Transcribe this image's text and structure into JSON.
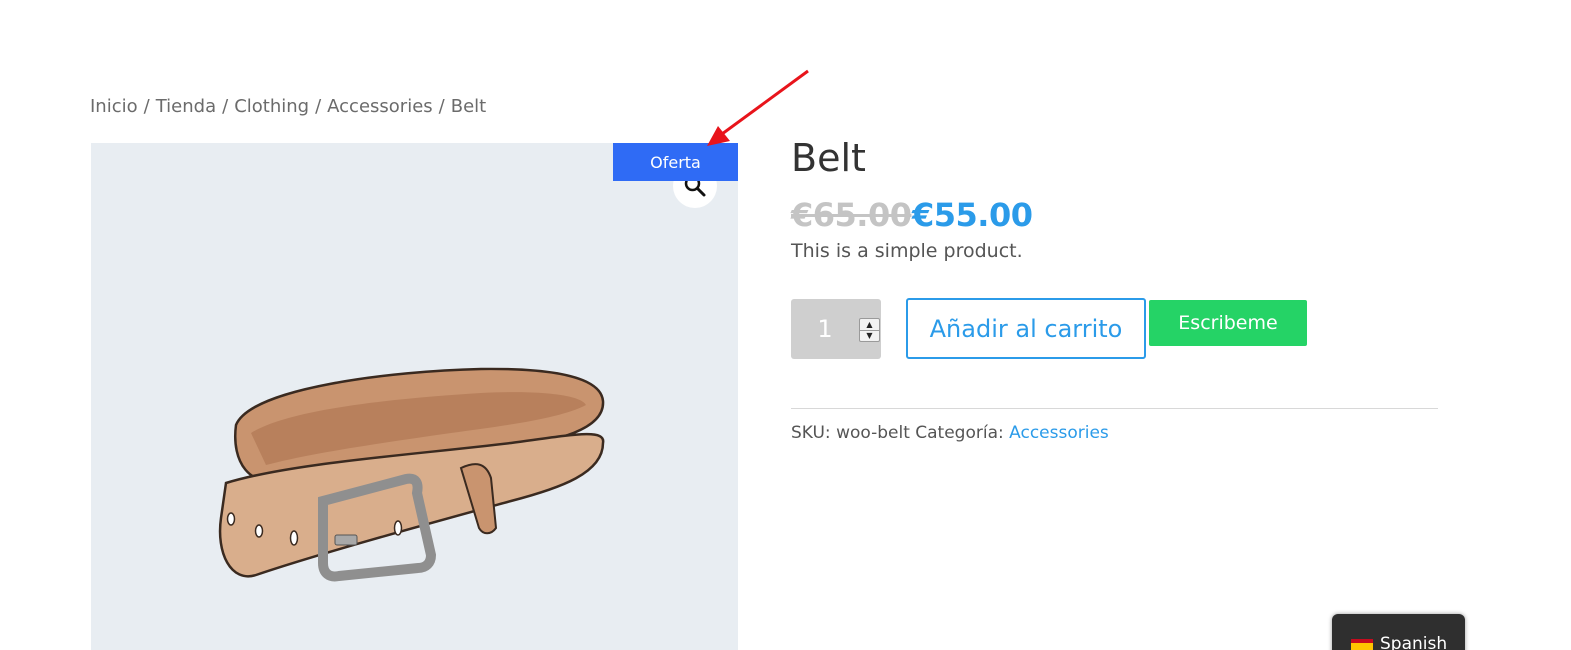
{
  "breadcrumb": {
    "items": [
      "Inicio",
      "Tienda",
      "Clothing",
      "Accessories",
      "Belt"
    ],
    "separator": "/"
  },
  "product": {
    "title": "Belt",
    "badge": "Oferta",
    "price_regular": "€65.00",
    "price_sale": "€55.00",
    "short_description": "This is a simple product.",
    "image_alt": "Leather belt illustration"
  },
  "cart": {
    "quantity": "1",
    "add_to_cart_label": "Añadir al carrito",
    "whatsapp_label": "Escribeme"
  },
  "meta": {
    "sku_label": "SKU:",
    "sku_value": "woo-belt",
    "category_label": "Categoría:",
    "category_value": "Accessories"
  },
  "language_switcher": {
    "label": "Spanish",
    "flag": "spain-flag-icon"
  },
  "icons": {
    "zoom": "magnifier-icon",
    "annotation": "red-arrow-annotation"
  },
  "colors": {
    "accent": "#2b9be9",
    "badge": "#2f6bf5",
    "whatsapp": "#25d366",
    "annotation": "#e8141b"
  }
}
